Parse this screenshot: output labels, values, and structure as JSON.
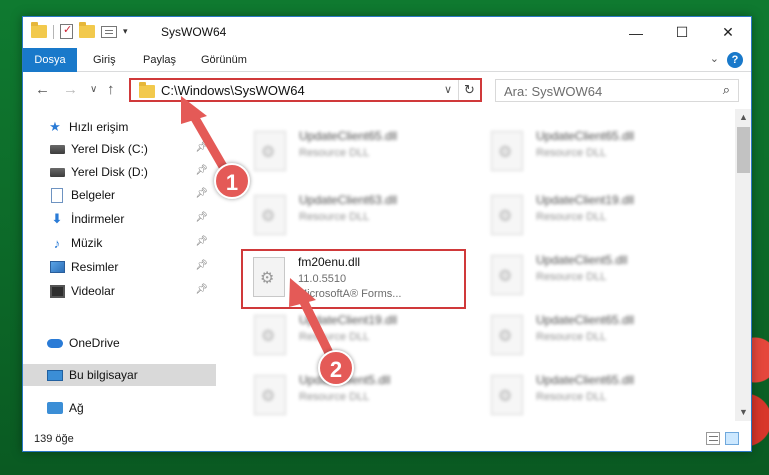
{
  "window": {
    "title": "SysWOW64",
    "minimize": "—",
    "maximize": "☐",
    "close": "✕"
  },
  "ribbon": {
    "tabs": [
      "Dosya",
      "Giriş",
      "Paylaş",
      "Görünüm"
    ],
    "help": "?"
  },
  "navbar": {
    "back": "←",
    "forward": "→",
    "recent": "∨",
    "up": "↑",
    "address": "C:\\Windows\\SysWOW64",
    "address_dropdown": "∨",
    "refresh": "↻",
    "search_placeholder": "Ara: SysWOW64"
  },
  "sidebar": {
    "items": [
      {
        "label": "Hızlı erişim",
        "icon": "star-icon"
      },
      {
        "label": "Yerel Disk (C:)",
        "icon": "disk-icon"
      },
      {
        "label": "Yerel Disk (D:)",
        "icon": "disk-icon"
      },
      {
        "label": "Belgeler",
        "icon": "documents-icon"
      },
      {
        "label": "İndirmeler",
        "icon": "downloads-icon"
      },
      {
        "label": "Müzik",
        "icon": "music-icon"
      },
      {
        "label": "Resimler",
        "icon": "pictures-icon"
      },
      {
        "label": "Videolar",
        "icon": "videos-icon"
      },
      {
        "label": "OneDrive",
        "icon": "onedrive-icon"
      },
      {
        "label": "Bu bilgisayar",
        "icon": "this-pc-icon"
      },
      {
        "label": "Ağ",
        "icon": "network-icon"
      }
    ]
  },
  "files": {
    "left": [
      {
        "name": "UpdateClient65.dll",
        "desc": "Resource DLL"
      },
      {
        "name": "UpdateClient63.dll",
        "desc": "Resource DLL"
      },
      {
        "name": "fm20enu.dll",
        "version": "11.0.5510",
        "desc": "MicrosoftA® Forms..."
      },
      {
        "name": "UpdateClient19.dll",
        "desc": "Resource DLL"
      },
      {
        "name": "UpdateClient5.dll",
        "desc": "Resource DLL"
      }
    ],
    "right": [
      {
        "name": "UpdateClient65.dll",
        "desc": "Resource DLL"
      },
      {
        "name": "UpdateClient19.dll",
        "desc": "Resource DLL"
      },
      {
        "name": "UpdateClient5.dll",
        "desc": "Resource DLL"
      },
      {
        "name": "UpdateClient65.dll",
        "desc": "Resource DLL"
      },
      {
        "name": "UpdateClient65.dll",
        "desc": "Resource DLL"
      }
    ]
  },
  "status": {
    "count": "139 öğe"
  },
  "annotations": {
    "step1": "1",
    "step2": "2"
  },
  "colors": {
    "accent": "#1979ca",
    "highlight_border": "#d0393a",
    "marker": "#e45a57"
  }
}
